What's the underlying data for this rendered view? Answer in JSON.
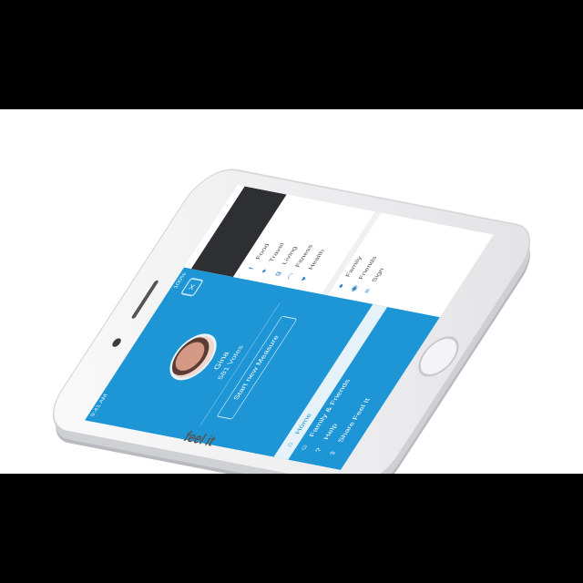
{
  "drawer": {
    "status_time": "9:41 AM",
    "status_battery": "100%",
    "close_icon": "close-icon",
    "user_name": "Gina",
    "user_handle": "581 Votes",
    "start_button": "Start new Measure",
    "menu": [
      {
        "label": "Home",
        "icon": "home-icon"
      },
      {
        "label": "Family & Friends",
        "icon": "people-icon"
      },
      {
        "label": "Help",
        "icon": "help-icon"
      },
      {
        "label": "Share Feel It",
        "icon": "share-icon"
      }
    ]
  },
  "app": {
    "logo": "feel it"
  },
  "content": {
    "top_rows": [
      {
        "label": "Food",
        "icon": "facebook-icon"
      },
      {
        "label": "Travel",
        "icon": "twitter-icon"
      },
      {
        "label": "Living",
        "icon": "google-icon"
      },
      {
        "label": "Fitness",
        "icon": "wifi-icon"
      },
      {
        "label": "Health",
        "icon": "heart-icon"
      }
    ],
    "bottom_rows": [
      {
        "label": "Family",
        "icon": "person-icon"
      },
      {
        "label": "Friends",
        "icon": "group-icon"
      },
      {
        "label": "Sign",
        "icon": "menu-icon"
      }
    ]
  },
  "colors": {
    "accent": "#1e96d6",
    "dark": "#2d2f33"
  }
}
